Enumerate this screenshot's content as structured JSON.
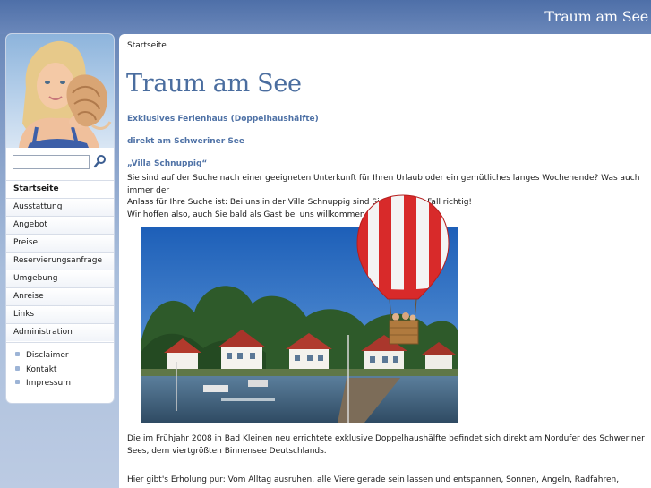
{
  "site": {
    "title": "Traum am See"
  },
  "search": {
    "value": "",
    "placeholder": ""
  },
  "nav": {
    "main": [
      {
        "label": "Startseite",
        "active": true
      },
      {
        "label": "Ausstattung",
        "active": false
      },
      {
        "label": "Angebot",
        "active": false
      },
      {
        "label": "Preise",
        "active": false
      },
      {
        "label": "Reservierungsanfrage",
        "active": false
      },
      {
        "label": "Umgebung",
        "active": false
      },
      {
        "label": "Anreise",
        "active": false
      },
      {
        "label": "Links",
        "active": false
      },
      {
        "label": "Administration",
        "active": false
      }
    ],
    "secondary": [
      {
        "label": "Disclaimer"
      },
      {
        "label": "Kontakt"
      },
      {
        "label": "Impressum"
      }
    ]
  },
  "content": {
    "breadcrumb": "Startseite",
    "title": "Traum am See",
    "lead1": "Exklusives Ferienhaus (Doppelhaushälfte)",
    "lead2": "direkt am Schweriner See",
    "villa_name": "„Villa Schnuppig“",
    "intro_line1": "Sie sind auf der Suche nach einer geeigneten Unterkunft für Ihren Urlaub oder ein gemütliches langes Wochenende? Was auch immer der",
    "intro_line2": "Anlass für Ihre Suche ist: Bei uns in der Villa Schnuppig sind Sie auf jeden Fall richtig!",
    "intro_line3": "Wir hoffen also, auch Sie bald als Gast bei uns willkommen heißen zu dürfen.",
    "para_location": "Die im Frühjahr 2008 in Bad Kleinen neu errichtete exklusive Doppelhaushälfte befindet sich direkt am Nordufer des Schweriner Sees, dem viertgrößten Binnensee Deutschlands.",
    "para_relax": "Hier gibt's Erholung pur: Vom Alltag ausruhen, alle Viere gerade sein lassen und entspannen, Sonnen, Angeln, Radfahren, Spazierengehen,"
  },
  "icons": {
    "search": "magnifier-icon",
    "bullet": "square-bullet-icon"
  },
  "colors": {
    "accent": "#4a6d9f",
    "lead_text": "#4f72a6",
    "header": "#5f7fb3",
    "bullet": "#9db4d6"
  }
}
